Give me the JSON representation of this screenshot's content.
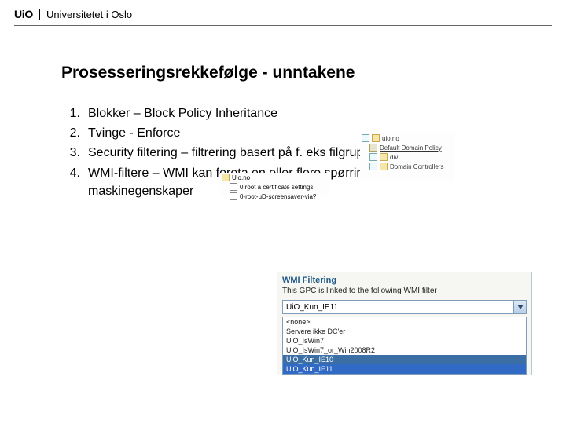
{
  "header": {
    "logo": "UiO",
    "university": "Universitetet i Oslo"
  },
  "slide": {
    "title": "Prosesseringsrekkefølge - unntakene",
    "items": [
      "Blokker – Block Policy Inheritance",
      "Tvinge - Enforce",
      "Security filtering – filtrering basert på f. eks filgrupper",
      "WMI-filtere – WMI kan foreta en eller flere spørringer om maskinegenskaper"
    ]
  },
  "inset1": {
    "root": "uio.no",
    "rows": [
      "Default Domain Policy",
      "div",
      "Domain Controllers"
    ]
  },
  "inset2": {
    "root": "Uio.no",
    "rows": [
      "0 root a certificate settings",
      "0-root-uD-screensaver-via?"
    ]
  },
  "wmi": {
    "section": "WMI Filtering",
    "desc": "This GPC is linked to the following WMI filter",
    "selected": "UiO_Kun_IE11",
    "options": [
      "<none>",
      "Servere ikke DC'er",
      "UiO_IsWin7",
      "UiO_IsWin7_or_Win2008R2",
      "UiO_Kun_IE10",
      "UiO_Kun_IE11"
    ]
  }
}
